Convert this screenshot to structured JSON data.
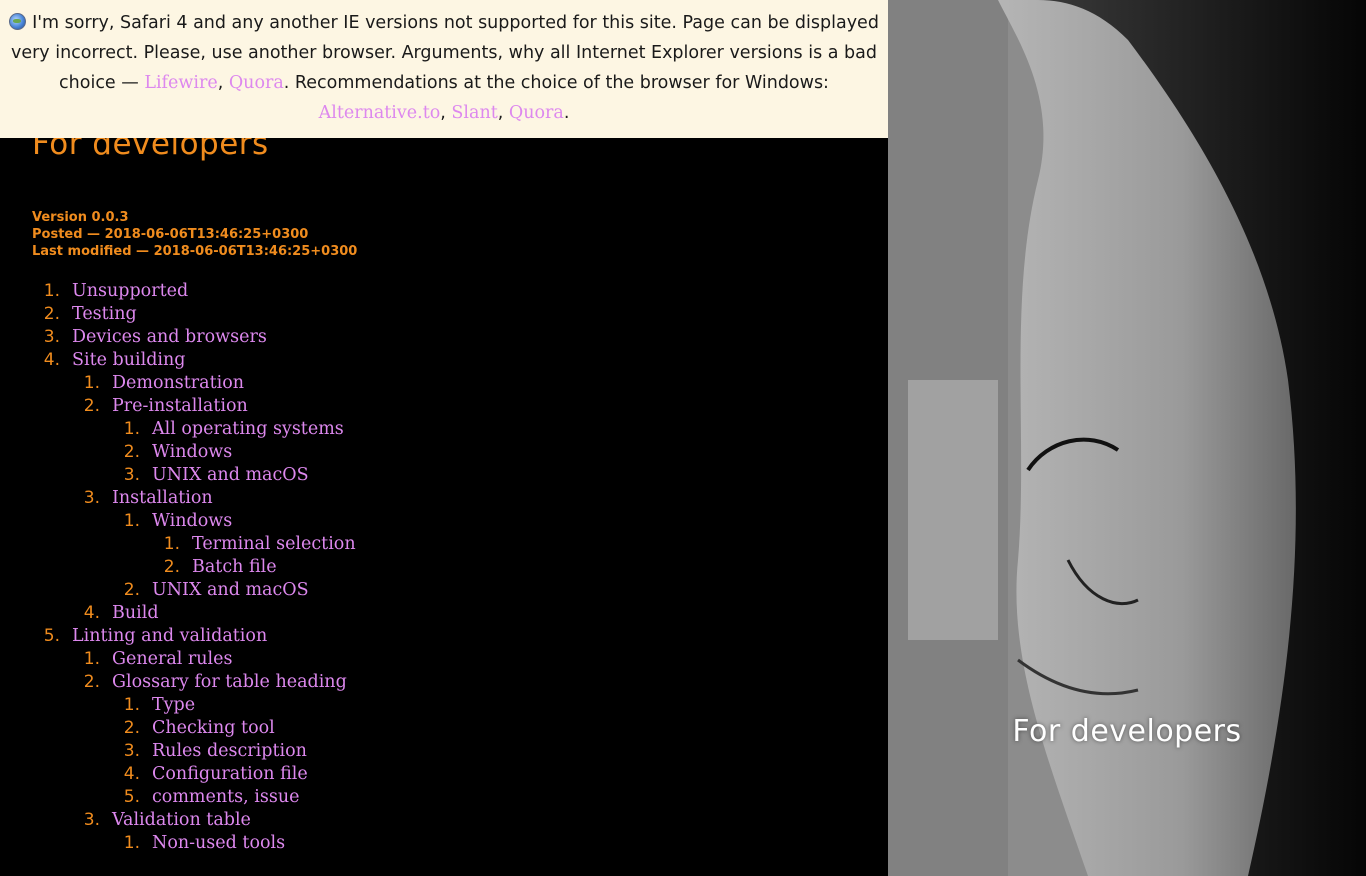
{
  "browser_warning": {
    "text_1": "I'm sorry, Safari 4 and any another IE versions not supported for this site. Page can be displayed very incorrect. Please, use another browser. Arguments, why all Internet Explorer versions is a bad choice — ",
    "links_1": [
      "Lifewire",
      "Quora"
    ],
    "text_2": ". Recommendations at the choice of the browser for Windows: ",
    "links_2": [
      "Alternative.to",
      "Slant",
      "Quora"
    ],
    "comma": ", ",
    "period": "."
  },
  "page": {
    "title": "For developers",
    "version": "Version 0.0.3",
    "posted": "Posted — 2018-06-06T13:46:25+0300",
    "modified": "Last modified — 2018-06-06T13:46:25+0300"
  },
  "toc": [
    {
      "num": "1.",
      "label": "Unsupported",
      "level": 0
    },
    {
      "num": "2.",
      "label": "Testing",
      "level": 0
    },
    {
      "num": "3.",
      "label": "Devices and browsers",
      "level": 0
    },
    {
      "num": "4.",
      "label": "Site building",
      "level": 0
    },
    {
      "num": "1.",
      "label": "Demonstration",
      "level": 1
    },
    {
      "num": "2.",
      "label": "Pre-installation",
      "level": 1
    },
    {
      "num": "1.",
      "label": "All operating systems",
      "level": 2
    },
    {
      "num": "2.",
      "label": "Windows",
      "level": 2
    },
    {
      "num": "3.",
      "label": "UNIX and macOS",
      "level": 2
    },
    {
      "num": "3.",
      "label": "Installation",
      "level": 1
    },
    {
      "num": "1.",
      "label": "Windows",
      "level": 2
    },
    {
      "num": "1.",
      "label": "Terminal selection",
      "level": 3
    },
    {
      "num": "2.",
      "label": "Batch file",
      "level": 3
    },
    {
      "num": "2.",
      "label": "UNIX and macOS",
      "level": 2
    },
    {
      "num": "4.",
      "label": "Build",
      "level": 1
    },
    {
      "num": "5.",
      "label": "Linting and validation",
      "level": 0
    },
    {
      "num": "1.",
      "label": "General rules",
      "level": 1
    },
    {
      "num": "2.",
      "label": "Glossary for table heading",
      "level": 1
    },
    {
      "num": "1.",
      "label": "Type",
      "level": 2
    },
    {
      "num": "2.",
      "label": "Checking tool",
      "level": 2
    },
    {
      "num": "3.",
      "label": "Rules description",
      "level": 2
    },
    {
      "num": "4.",
      "label": "Configuration file",
      "level": 2
    },
    {
      "num": "5.",
      "label": "comments, issue",
      "level": 2
    },
    {
      "num": "3.",
      "label": "Validation table",
      "level": 1
    },
    {
      "num": "1.",
      "label": "Non-used tools",
      "level": 2
    }
  ],
  "aside": {
    "title": "For developers"
  },
  "colors": {
    "accent": "#f08c1e",
    "link": "#dd88ee",
    "warning_bg": "#fdf6e3"
  },
  "icons": {
    "warning": "globe-icon"
  }
}
